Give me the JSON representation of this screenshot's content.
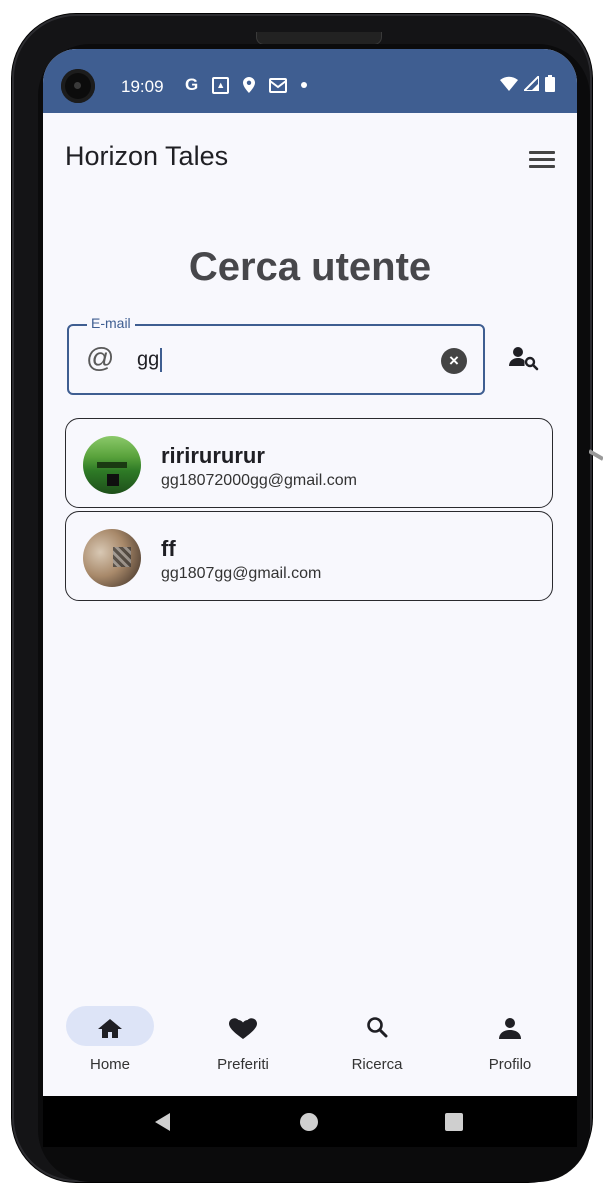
{
  "status_bar": {
    "time": "19:09",
    "icons": [
      "google-icon",
      "photo-icon",
      "location-icon",
      "mail-icon",
      "dot-icon",
      "wifi-icon",
      "signal-icon",
      "battery-icon"
    ]
  },
  "app_bar": {
    "title": "Horizon Tales",
    "menu_icon": "menu-icon"
  },
  "page": {
    "title": "Cerca utente"
  },
  "search": {
    "label": "E-mail",
    "value": "gg",
    "prefix_icon": "at-icon",
    "clear_icon": "clear-icon",
    "action_icon": "user-search-icon"
  },
  "results": [
    {
      "name": "ririrururur",
      "email": "gg18072000gg@gmail.com",
      "avatar": "avatar"
    },
    {
      "name": "ff",
      "email": "gg1807gg@gmail.com",
      "avatar": "avatar"
    }
  ],
  "bottom_nav": {
    "items": [
      {
        "label": "Home",
        "icon": "home-icon",
        "active": true
      },
      {
        "label": "Preferiti",
        "icon": "heart-icon",
        "active": false
      },
      {
        "label": "Ricerca",
        "icon": "search-icon",
        "active": false
      },
      {
        "label": "Profilo",
        "icon": "person-icon",
        "active": false
      }
    ]
  },
  "colors": {
    "primary": "#3f5e91",
    "background": "#f8f8fd",
    "active_pill": "#dde4f7",
    "title": "#47474b"
  }
}
